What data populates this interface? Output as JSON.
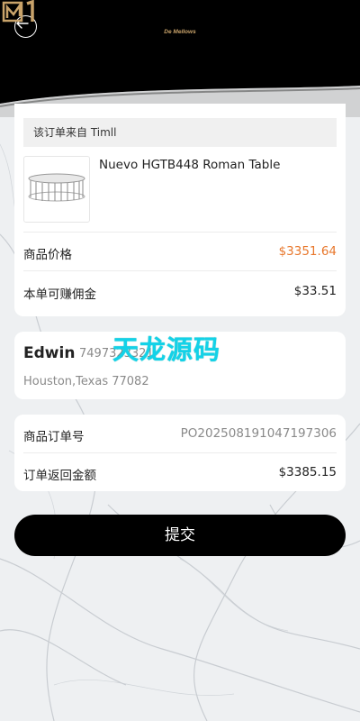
{
  "header": {
    "logo_text": "De Mellows",
    "back_icon": "arrow-left-icon"
  },
  "order_source": "该订单来自 Timll",
  "product": {
    "name": "Nuevo HGTB448 Roman Table",
    "price_label": "商品价格",
    "price_value": "$3351.64",
    "commission_label": "本单可赚佣金",
    "commission_value": "$33.51"
  },
  "customer": {
    "name": "Edwin",
    "phone": "7497323321",
    "address": "Houston,Texas 77082"
  },
  "watermark": "天龙源码",
  "order": {
    "number_label": "商品订单号",
    "number_value": "PO202508191047197306",
    "return_label": "订单返回金额",
    "return_value": "$3385.15"
  },
  "submit_label": "提交",
  "colors": {
    "accent_orange": "#e8782d",
    "button": "#000000",
    "logo_gold": "#c9a36a",
    "watermark": "#13d2e8"
  }
}
